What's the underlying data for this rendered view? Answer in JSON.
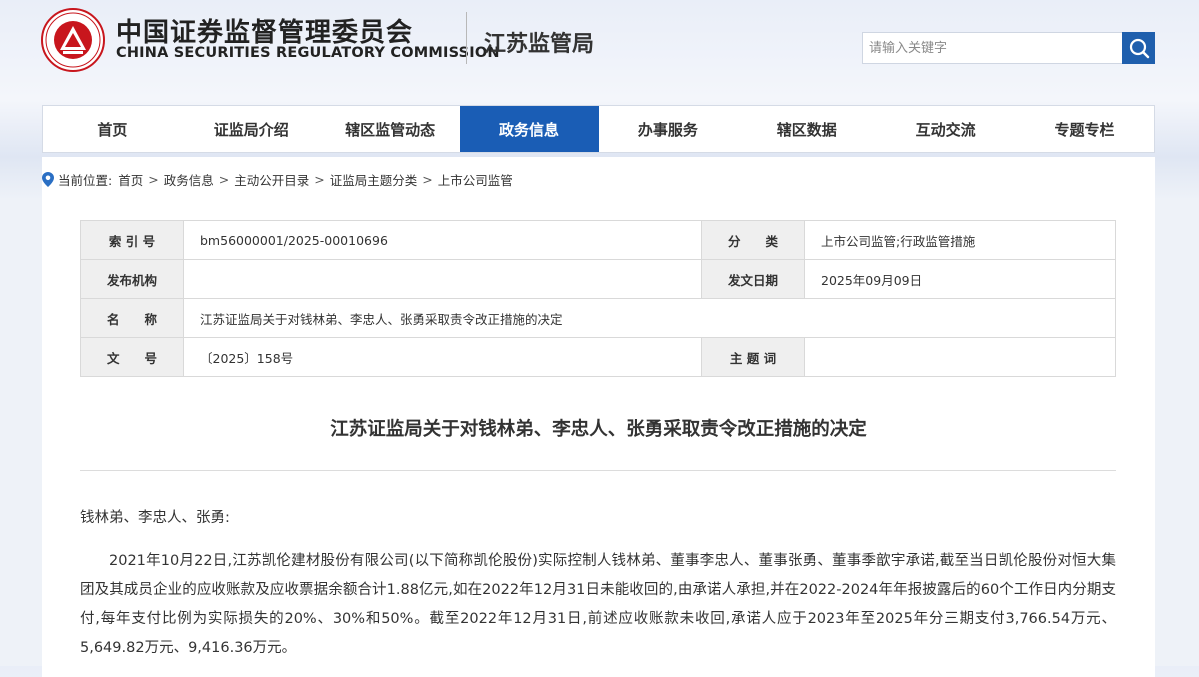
{
  "header": {
    "cn_title": "中国证券监督管理委员会",
    "en_title": "CHINA SECURITIES REGULATORY COMMISSION",
    "bureau": "江苏监管局",
    "search_placeholder": "请输入关键字",
    "brand_color": "#1a5db5",
    "logo_color": "#c8161d"
  },
  "nav": {
    "items": [
      "首页",
      "证监局介绍",
      "辖区监管动态",
      "政务信息",
      "办事服务",
      "辖区数据",
      "互动交流",
      "专题专栏"
    ],
    "active": "政务信息"
  },
  "breadcrumb": {
    "prefix": "当前位置:",
    "items": [
      "首页",
      "政务信息",
      "主动公开目录",
      "证监局主题分类",
      "上市公司监管"
    ],
    "separator": ">"
  },
  "info": {
    "index_label": "索 引 号",
    "index_value": "bm56000001/2025-00010696",
    "category_label": "分　　类",
    "category_value": "上市公司监管;行政监管措施",
    "publisher_label": "发布机构",
    "publisher_value": "",
    "date_label": "发文日期",
    "date_value": "2025年09月09日",
    "name_label": "名　　称",
    "name_value": "江苏证监局关于对钱林弟、李忠人、张勇采取责令改正措施的决定",
    "docno_label": "文　　号",
    "docno_value": "〔2025〕158号",
    "topic_label": "主 题 词",
    "topic_value": ""
  },
  "document": {
    "title": "江苏证监局关于对钱林弟、李忠人、张勇采取责令改正措施的决定",
    "salutation": "钱林弟、李忠人、张勇:",
    "paragraph1": "2021年10月22日,江苏凯伦建材股份有限公司(以下简称凯伦股份)实际控制人钱林弟、董事李忠人、董事张勇、董事季歆宇承诺,截至当日凯伦股份对恒大集团及其成员企业的应收账款及应收票据余额合计1.88亿元,如在2022年12月31日未能收回的,由承诺人承担,并在2022-2024年年报披露后的60个工作日内分期支付,每年支付比例为实际损失的20%、30%和50%。截至2022年12月31日,前述应收账款未收回,承诺人应于2023年至2025年分三期支付3,766.54万元、5,649.82万元、9,416.36万元。"
  }
}
